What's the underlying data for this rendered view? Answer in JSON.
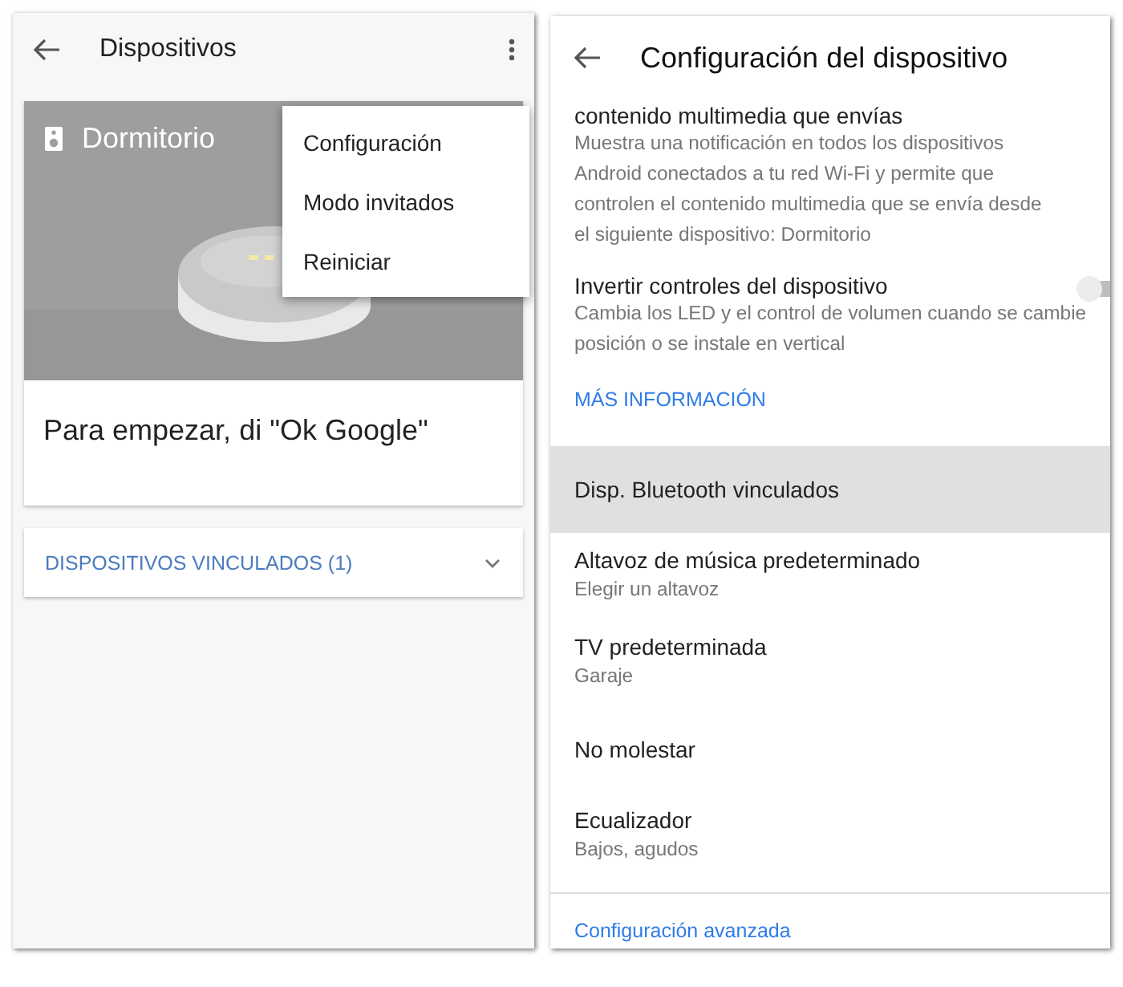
{
  "left": {
    "title": "Dispositivos",
    "device_card": {
      "name": "Dormitorio",
      "prompt": "Para empezar, di \"Ok Google\""
    },
    "menu": [
      {
        "label": "Configuración"
      },
      {
        "label": "Modo invitados"
      },
      {
        "label": "Reiniciar"
      }
    ],
    "linked": {
      "label": "DISPOSITIVOS VINCULADOS (1)",
      "expanded": false
    }
  },
  "right": {
    "title": "Configuración del dispositivo",
    "settings": [
      {
        "kind": "text",
        "title": "contenido multimedia que envías",
        "description": "Muestra una notificación en todos los dispositivos Android conectados a tu red Wi-Fi y permite que controlen el contenido multimedia que se envía desde el siguiente dispositivo: Dormitorio"
      },
      {
        "kind": "toggle",
        "title": "Invertir controles del dispositivo",
        "description": "Cambia los LED y el control de volumen cuando se cambie posición o se instale en vertical",
        "on": false
      },
      {
        "kind": "link",
        "title": "MÁS INFORMACIÓN"
      }
    ],
    "items": [
      {
        "title": "Disp. Bluetooth vinculados",
        "selected": true
      },
      {
        "title": "Altavoz de música predeterminado",
        "subtitle": "Elegir un altavoz",
        "selected": false
      },
      {
        "title": "TV predeterminada",
        "subtitle": "Garaje",
        "selected": false
      },
      {
        "title": "No molestar",
        "selected": false
      },
      {
        "title": "Ecualizador",
        "subtitle": "Bajos, agudos",
        "selected": false
      }
    ],
    "footer_link": "Configuración avanzada"
  }
}
